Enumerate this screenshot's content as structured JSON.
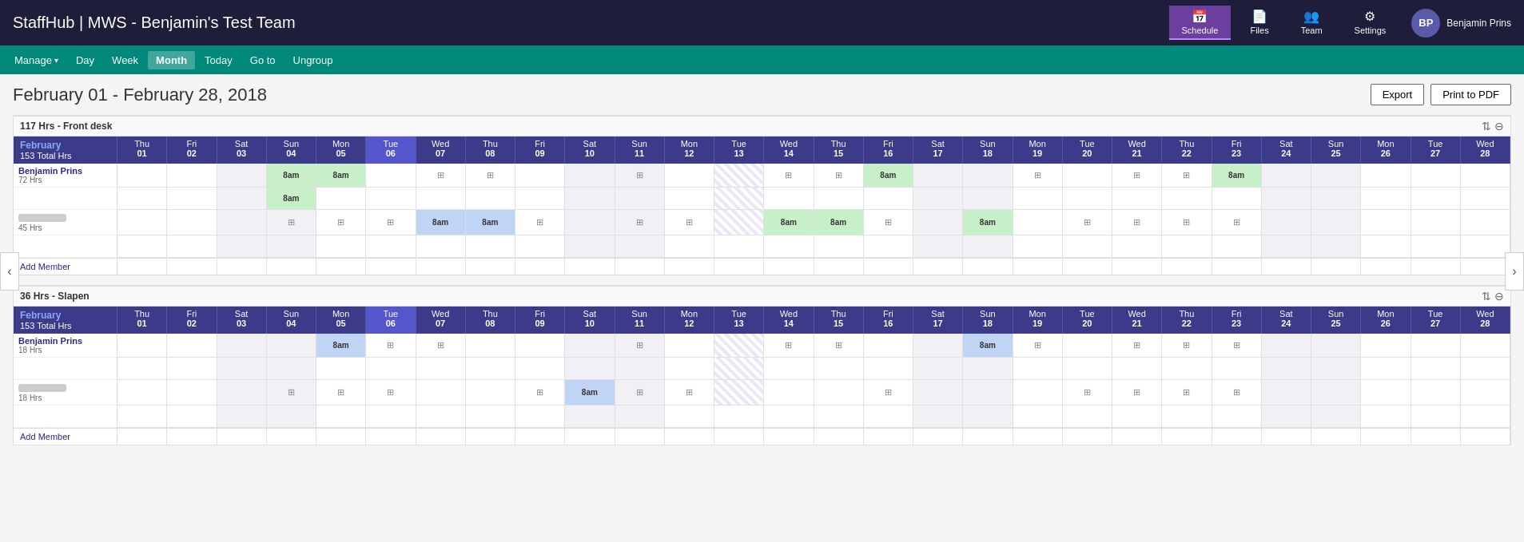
{
  "app": {
    "title": "StaffHub | MWS - Benjamin's Test Team"
  },
  "nav": {
    "items": [
      {
        "id": "schedule",
        "label": "Schedule",
        "icon": "📅",
        "active": true
      },
      {
        "id": "files",
        "label": "Files",
        "icon": "📄",
        "active": false
      },
      {
        "id": "team",
        "label": "Team",
        "icon": "👥",
        "active": false
      },
      {
        "id": "settings",
        "label": "Settings",
        "icon": "⚙",
        "active": false
      }
    ],
    "user": {
      "initials": "BP",
      "name": "Benjamin Prins"
    }
  },
  "toolbar": {
    "manage_label": "Manage",
    "day_label": "Day",
    "week_label": "Week",
    "month_label": "Month",
    "today_label": "Today",
    "goto_label": "Go to",
    "ungroup_label": "Ungroup"
  },
  "dateRange": {
    "title": "February 01 - February 28, 2018",
    "exportLabel": "Export",
    "printLabel": "Print to PDF"
  },
  "calendar": {
    "monthName": "February",
    "totalHrs": "153 Total Hrs",
    "days": [
      {
        "name": "Thu",
        "num": "01",
        "weekend": false,
        "today": false
      },
      {
        "name": "Fri",
        "num": "02",
        "weekend": false,
        "today": false
      },
      {
        "name": "Sat",
        "num": "03",
        "weekend": true,
        "today": false
      },
      {
        "name": "Sun",
        "num": "04",
        "weekend": true,
        "today": false
      },
      {
        "name": "Mon",
        "num": "05",
        "weekend": false,
        "today": false
      },
      {
        "name": "Tue",
        "num": "06",
        "weekend": false,
        "today": true
      },
      {
        "name": "Wed",
        "num": "07",
        "weekend": false,
        "today": false
      },
      {
        "name": "Thu",
        "num": "08",
        "weekend": false,
        "today": false
      },
      {
        "name": "Fri",
        "num": "09",
        "weekend": false,
        "today": false
      },
      {
        "name": "Sat",
        "num": "10",
        "weekend": true,
        "today": false
      },
      {
        "name": "Sun",
        "num": "11",
        "weekend": true,
        "today": false
      },
      {
        "name": "Mon",
        "num": "12",
        "weekend": false,
        "today": false
      },
      {
        "name": "Tue",
        "num": "13",
        "weekend": false,
        "today": false
      },
      {
        "name": "Wed",
        "num": "14",
        "weekend": false,
        "today": false
      },
      {
        "name": "Thu",
        "num": "15",
        "weekend": false,
        "today": false
      },
      {
        "name": "Fri",
        "num": "16",
        "weekend": false,
        "today": false
      },
      {
        "name": "Sat",
        "num": "17",
        "weekend": true,
        "today": false
      },
      {
        "name": "Sun",
        "num": "18",
        "weekend": true,
        "today": false
      },
      {
        "name": "Mon",
        "num": "19",
        "weekend": false,
        "today": false
      },
      {
        "name": "Tue",
        "num": "20",
        "weekend": false,
        "today": false
      },
      {
        "name": "Wed",
        "num": "21",
        "weekend": false,
        "today": false
      },
      {
        "name": "Thu",
        "num": "22",
        "weekend": false,
        "today": false
      },
      {
        "name": "Fri",
        "num": "23",
        "weekend": false,
        "today": false
      },
      {
        "name": "Sat",
        "num": "24",
        "weekend": true,
        "today": false
      },
      {
        "name": "Sun",
        "num": "25",
        "weekend": true,
        "today": false
      },
      {
        "name": "Mon",
        "num": "26",
        "weekend": false,
        "today": false
      },
      {
        "name": "Tue",
        "num": "27",
        "weekend": false,
        "today": false
      },
      {
        "name": "Wed",
        "num": "28",
        "weekend": false,
        "today": false
      }
    ]
  },
  "groups": [
    {
      "id": "front-desk",
      "title": "117 Hrs - Front desk",
      "members": [
        {
          "name": "Benjamin Prins",
          "hrs": "72 Hrs",
          "blurred": false,
          "rows": [
            [
              "",
              "",
              "",
              "green",
              "green",
              "",
              "icon",
              "icon",
              "",
              "",
              "icon",
              "",
              "hatched",
              "icon",
              "icon",
              "green",
              "",
              "",
              "icon",
              "",
              "icon",
              "icon",
              "green",
              "",
              "",
              "",
              "",
              ""
            ],
            [
              "",
              "",
              "",
              "green",
              "",
              "",
              "",
              "",
              "",
              "",
              "",
              "",
              "hatched",
              "",
              "",
              "",
              "",
              "",
              "",
              "",
              "",
              "",
              "",
              "",
              "",
              "",
              "",
              ""
            ]
          ]
        },
        {
          "name": "",
          "hrs": "45 Hrs",
          "blurred": true,
          "rows": [
            [
              "",
              "",
              "",
              "icon",
              "icon",
              "icon",
              "blue",
              "blue",
              "icon",
              "",
              "icon",
              "icon",
              "hatched",
              "green",
              "green",
              "icon",
              "",
              "green",
              "",
              "icon",
              "icon",
              "icon",
              "icon",
              "",
              "",
              "",
              "",
              ""
            ],
            [
              "",
              "",
              "",
              "",
              "",
              "",
              "",
              "",
              "",
              "",
              "",
              "",
              "",
              "",
              "",
              "",
              "",
              "",
              "",
              "",
              "",
              "",
              "",
              "",
              "",
              "",
              "",
              ""
            ]
          ]
        }
      ],
      "addMemberLabel": "Add Member"
    },
    {
      "id": "slapen",
      "title": "36 Hrs - Slapen",
      "members": [
        {
          "name": "Benjamin Prins",
          "hrs": "18 Hrs",
          "blurred": false,
          "rows": [
            [
              "",
              "",
              "",
              "",
              "blue",
              "icon",
              "icon",
              "",
              "",
              "",
              "icon",
              "",
              "hatched",
              "icon",
              "icon",
              "",
              "",
              "blue",
              "icon",
              "",
              "icon",
              "icon",
              "icon",
              "",
              "",
              "",
              "",
              ""
            ],
            [
              "",
              "",
              "",
              "",
              "",
              "",
              "",
              "",
              "",
              "",
              "",
              "",
              "hatched",
              "",
              "",
              "",
              "",
              "",
              "",
              "",
              "",
              "",
              "",
              "",
              "",
              "",
              "",
              ""
            ]
          ]
        },
        {
          "name": "",
          "hrs": "18 Hrs",
          "blurred": true,
          "rows": [
            [
              "",
              "",
              "",
              "icon",
              "icon",
              "icon",
              "",
              "",
              "icon",
              "blue",
              "icon",
              "icon",
              "hatched",
              "",
              "",
              "icon",
              "",
              "",
              "",
              "icon",
              "icon",
              "icon",
              "icon",
              "",
              "",
              "",
              "",
              ""
            ],
            [
              "",
              "",
              "",
              "",
              "",
              "",
              "",
              "",
              "",
              "",
              "",
              "",
              "",
              "",
              "",
              "",
              "",
              "",
              "",
              "",
              "",
              "",
              "",
              "",
              "",
              "",
              "",
              ""
            ]
          ]
        }
      ],
      "addMemberLabel": "Add Member"
    }
  ]
}
